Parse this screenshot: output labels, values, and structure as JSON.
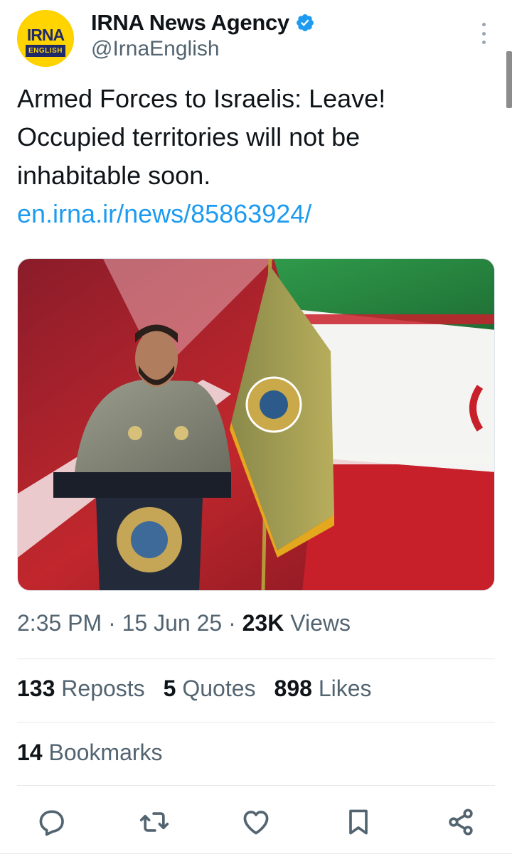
{
  "author": {
    "avatar_text": "IRNA",
    "avatar_subtext": "ENGLISH",
    "display_name": "IRNA News Agency",
    "handle": "@IrnaEnglish",
    "verified": true
  },
  "tweet": {
    "text_lines": [
      "Armed Forces to Israelis: Leave!",
      "Occupied territories will not be",
      "inhabitable soon."
    ],
    "link": "en.irna.ir/news/85863924/"
  },
  "meta": {
    "time": "2:35 PM",
    "date": "15 Jun 25",
    "views_count": "23K",
    "views_label": "Views"
  },
  "stats": {
    "reposts_count": "133",
    "reposts_label": "Reposts",
    "quotes_count": "5",
    "quotes_label": "Quotes",
    "likes_count": "898",
    "likes_label": "Likes",
    "bookmarks_count": "14",
    "bookmarks_label": "Bookmarks"
  },
  "actions": {
    "icons": [
      "reply-icon",
      "repost-icon",
      "like-icon",
      "bookmark-icon",
      "share-icon"
    ]
  },
  "colors": {
    "link": "#1d9bf0",
    "verified": "#1d9bf0",
    "secondary_text": "#536471",
    "primary_text": "#0f1419"
  }
}
